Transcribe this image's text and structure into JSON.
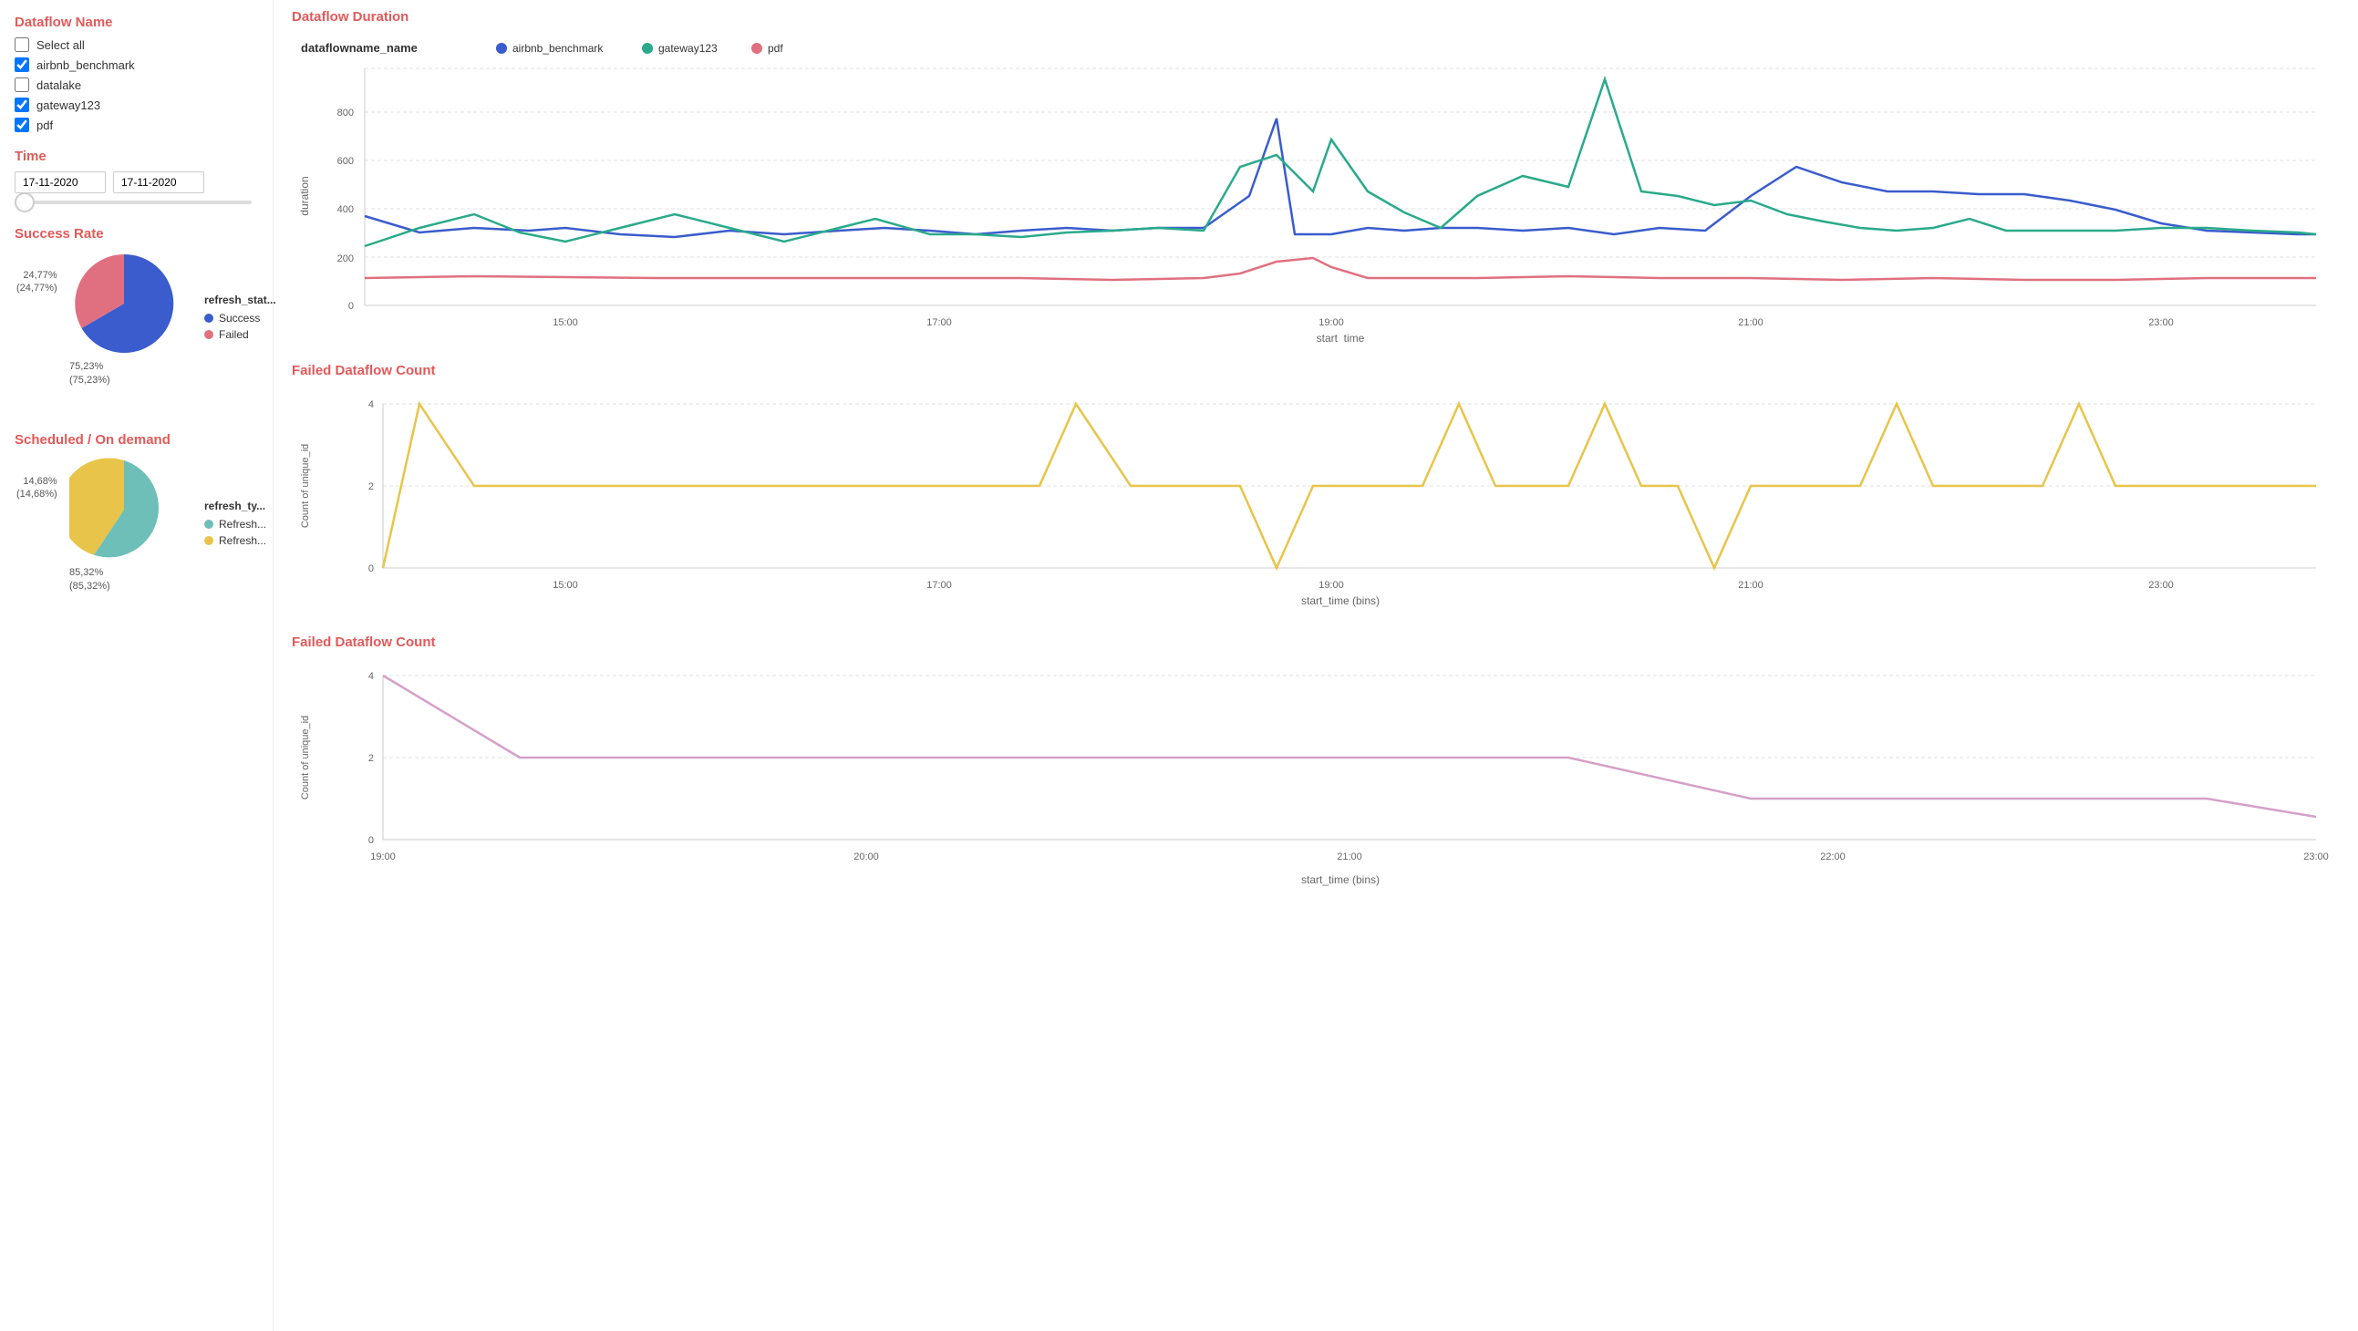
{
  "sidebar": {
    "dataflow_name_title": "Dataflow Name",
    "select_all_label": "Select all",
    "checkboxes": [
      {
        "label": "airbnb_benchmark",
        "checked": true
      },
      {
        "label": "datalake",
        "checked": false
      },
      {
        "label": "gateway123",
        "checked": true
      },
      {
        "label": "pdf",
        "checked": true
      }
    ],
    "time_title": "Time",
    "date_from": "17-11-2020",
    "date_to": "17-11-2020"
  },
  "success_rate": {
    "title": "Success Rate",
    "legend_title": "refresh_stat...",
    "items": [
      {
        "label": "Success",
        "color": "#3a5ccc",
        "pct": 75.23
      },
      {
        "label": "Failed",
        "color": "#e07080",
        "pct": 24.77
      }
    ],
    "label_top": "24,77%",
    "label_top2": "(24,77%)",
    "label_bottom": "75,23%",
    "label_bottom2": "(75,23%)"
  },
  "scheduled": {
    "title": "Scheduled / On demand",
    "legend_title": "refresh_ty...",
    "items": [
      {
        "label": "Refresh...",
        "color": "#6dbfb8",
        "pct": 85.32
      },
      {
        "label": "Refresh...",
        "color": "#e8c44a",
        "pct": 14.68
      }
    ],
    "label_top": "14,68%",
    "label_top2": "(14,68%)",
    "label_bottom": "85,32%",
    "label_bottom2": "(85,32%)"
  },
  "duration_chart": {
    "title": "Dataflow Duration",
    "legend_label": "dataflowname_name",
    "series": [
      "airbnb_benchmark",
      "gateway123",
      "pdf"
    ],
    "series_colors": [
      "#3a5ccc",
      "#2aaa8a",
      "#e07080"
    ],
    "y_label": "duration",
    "x_label": "start_time",
    "y_ticks": [
      0,
      200,
      400,
      600,
      800
    ],
    "x_ticks": [
      "15:00",
      "17:00",
      "19:00",
      "21:00",
      "23:00"
    ]
  },
  "failed_count_chart1": {
    "title": "Failed Dataflow Count",
    "y_label": "Count of unique_id",
    "x_label": "start_time (bins)",
    "color": "#e8c44a",
    "y_ticks": [
      0,
      2,
      4
    ],
    "x_ticks": [
      "15:00",
      "17:00",
      "19:00",
      "21:00",
      "23:00"
    ]
  },
  "failed_count_chart2": {
    "title": "Failed Dataflow Count",
    "y_label": "Count of unique_id",
    "x_label": "start_time (bins)",
    "color": "#d4a0c8",
    "y_ticks": [
      0,
      2,
      4
    ],
    "x_ticks": [
      "19:00",
      "20:00",
      "21:00",
      "22:00",
      "23:00"
    ]
  }
}
